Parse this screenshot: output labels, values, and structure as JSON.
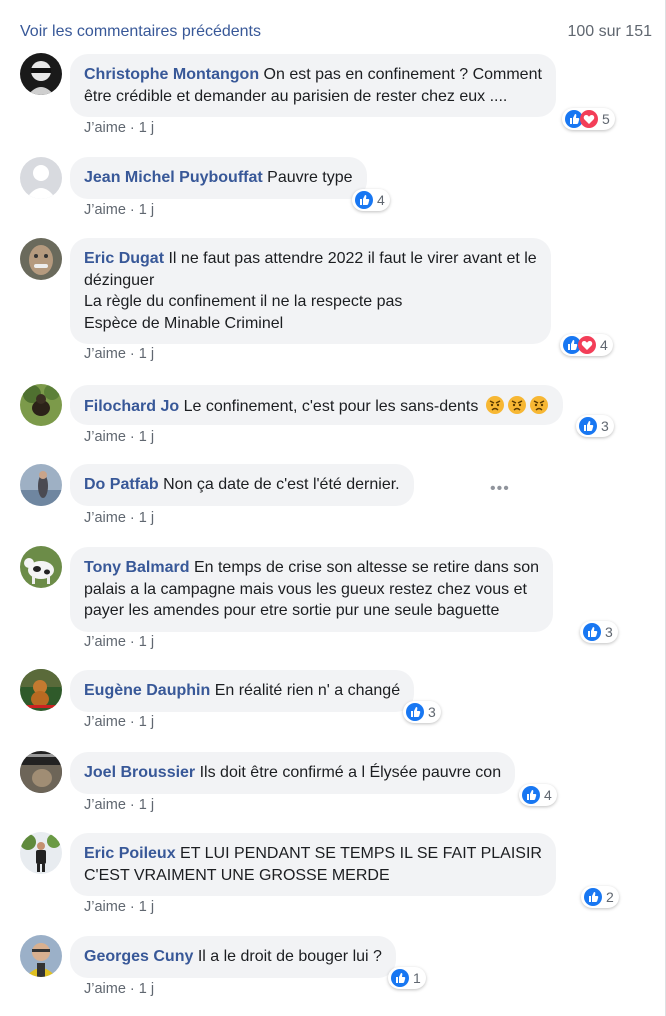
{
  "header": {
    "more_comments": "Voir les commentaires précédents",
    "count": "100 sur 151"
  },
  "meta": {
    "like": "J’aime",
    "time": "1 j"
  },
  "colors": {
    "link": "#385898",
    "bubble": "#f2f3f5",
    "like_blue": "#1877f2",
    "love_red": "#f33e58"
  },
  "comments": [
    {
      "author": "Christophe Montangon",
      "lines": [
        "On est pas en confinement ? Comment",
        "être crédible et demander au parisien de rester chez eux ...."
      ],
      "reaction_count": "5",
      "reactions": [
        "like-icon",
        "love-icon"
      ]
    },
    {
      "author": "Jean Michel Puybouffat",
      "lines": [
        "Pauvre type"
      ],
      "reaction_count": "4",
      "reactions": [
        "like-icon"
      ]
    },
    {
      "author": "Eric Dugat",
      "lines": [
        "Il ne faut pas attendre 2022 il faut le virer avant et le",
        "dézinguer",
        "La règle du confinement il ne la respecte pas",
        "Espèce de Minable Criminel"
      ],
      "reaction_count": "4",
      "reactions": [
        "like-icon",
        "love-icon"
      ]
    },
    {
      "author": "Filochard Jo",
      "lines": [
        "Le confinement, c'est pour les sans-dents"
      ],
      "emojis": [
        "angry-face-icon",
        "angry-face-icon",
        "angry-face-icon"
      ],
      "reaction_count": "3",
      "reactions": [
        "like-icon"
      ]
    },
    {
      "author": "Do Patfab",
      "lines": [
        "Non ça date de c'est l'été dernier."
      ],
      "reaction_count": "",
      "reactions": []
    },
    {
      "author": "Tony Balmard",
      "lines": [
        "En temps de crise son altesse se retire dans son",
        "palais a la campagne mais vous les gueux restez chez vous et",
        "payer les amendes pour etre sortie pur une seule baguette"
      ],
      "reaction_count": "3",
      "reactions": [
        "like-icon"
      ]
    },
    {
      "author": "Eugène Dauphin",
      "lines": [
        "En réalité rien n' a changé"
      ],
      "reaction_count": "3",
      "reactions": [
        "like-icon"
      ]
    },
    {
      "author": "Joel Broussier",
      "lines": [
        "Ils doit être confirmé a l Élysée pauvre con"
      ],
      "reaction_count": "4",
      "reactions": [
        "like-icon"
      ]
    },
    {
      "author": "Eric Poileux",
      "lines": [
        "ET LUI PENDANT SE TEMPS IL SE FAIT PLAISIR",
        "C'EST VRAIMENT UNE GROSSE MERDE"
      ],
      "reaction_count": "2",
      "reactions": [
        "like-icon"
      ]
    },
    {
      "author": "Georges Cuny",
      "lines": [
        "Il a le droit de bouger lui ?"
      ],
      "reaction_count": "1",
      "reactions": [
        "like-icon"
      ]
    }
  ]
}
